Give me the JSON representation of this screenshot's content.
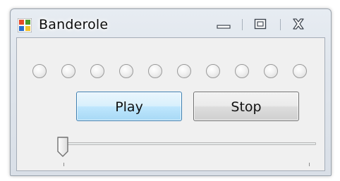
{
  "window": {
    "title": "Banderole",
    "app_icon": "windows-logo-icon",
    "caption_buttons": [
      {
        "name": "minimize",
        "icon": "minimize-icon"
      },
      {
        "name": "maximize",
        "icon": "maximize-icon"
      },
      {
        "name": "close",
        "icon": "close-icon"
      }
    ]
  },
  "leds": {
    "count": 10,
    "states": [
      false,
      false,
      false,
      false,
      false,
      false,
      false,
      false,
      false,
      false
    ]
  },
  "buttons": {
    "play_label": "Play",
    "stop_label": "Stop",
    "play_state": "hover"
  },
  "slider": {
    "value_fraction": 0.0
  },
  "colors": {
    "client_background": "#f0f0f0",
    "play_hover_border": "#3c7fb1",
    "led_off": "#e8e8e8"
  }
}
